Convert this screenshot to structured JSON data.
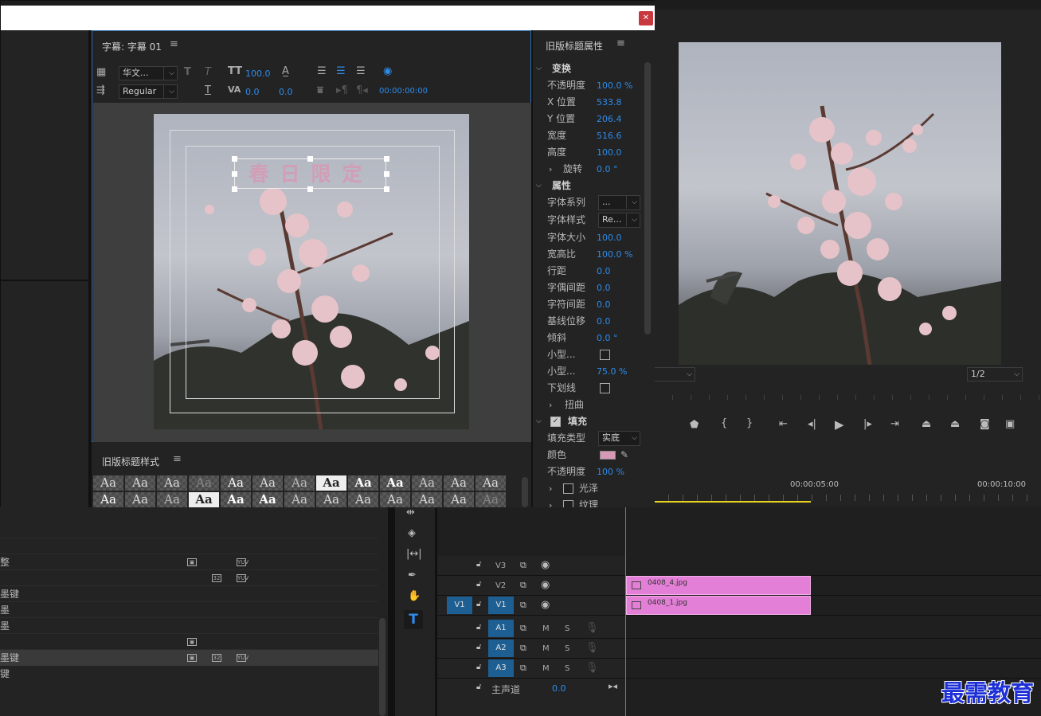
{
  "title_panel": {
    "tab_label": "字幕: 字幕 01",
    "font_family": "华文...",
    "font_style": "Regular",
    "font_size": "100.0",
    "kerning": "0.0",
    "leading": "0.0",
    "timecode": "00:00:00:00",
    "title_text": "春日限定"
  },
  "properties": {
    "header": "旧版标题属性",
    "transform_label": "变换",
    "rows_transform": [
      {
        "label": "不透明度",
        "value": "100.0 %"
      },
      {
        "label": "X 位置",
        "value": "533.8"
      },
      {
        "label": "Y 位置",
        "value": "206.4"
      },
      {
        "label": "宽度",
        "value": "516.6"
      },
      {
        "label": "高度",
        "value": "100.0"
      },
      {
        "label": "旋转",
        "value": "0.0 °"
      }
    ],
    "attr_label": "属性",
    "font_family_label": "字体系列",
    "font_family_value": "...",
    "font_style_label": "字体样式",
    "font_style_value": "Re...",
    "rows_attr": [
      {
        "label": "字体大小",
        "value": "100.0"
      },
      {
        "label": "宽高比",
        "value": "100.0 %"
      },
      {
        "label": "行距",
        "value": "0.0"
      },
      {
        "label": "字偶间距",
        "value": "0.0"
      },
      {
        "label": "字符间距",
        "value": "0.0"
      },
      {
        "label": "基线位移",
        "value": "0.0"
      },
      {
        "label": "倾斜",
        "value": "0.0 °"
      }
    ],
    "smallcaps_label": "小型...",
    "smallcaps_size_label": "小型...",
    "smallcaps_size_value": "75.0 %",
    "underline_label": "下划线",
    "distort_label": "扭曲",
    "fill_label": "填充",
    "fill_type_label": "填充类型",
    "fill_type_value": "实底",
    "color_label": "颜色",
    "fill_color": "#d79ab5",
    "fill_opacity_label": "不透明度",
    "fill_opacity_value": "100 %",
    "sheen_label": "光泽",
    "texture_label": "纹理"
  },
  "styles_panel": {
    "tab_label": "旧版标题样式",
    "swatch_text": "Aa"
  },
  "program_monitor": {
    "fit_value": "1/2",
    "ruler_marks": [
      "00:00:05:00",
      "00:00:10:00"
    ]
  },
  "timeline": {
    "video_tracks": [
      {
        "name": "V3"
      },
      {
        "name": "V2",
        "clip": "0408_4.jpg"
      },
      {
        "name": "V1",
        "clip": "0408_1.jpg",
        "source": "V1"
      }
    ],
    "audio_tracks": [
      {
        "name": "A1"
      },
      {
        "name": "A2"
      },
      {
        "name": "A3"
      }
    ],
    "master_label": "主声道",
    "master_value": "0.0",
    "mute": "M",
    "solo": "S"
  },
  "left_list": [
    {
      "text": "整",
      "row": 3
    },
    {
      "text": "",
      "row": 4
    },
    {
      "text": "墨键",
      "row": 5
    },
    {
      "text": "墨",
      "row": 6
    },
    {
      "text": "墨",
      "row": 7
    },
    {
      "text": "",
      "row": 8
    },
    {
      "text": "墨键",
      "row": 9
    },
    {
      "text": "键",
      "row": 10
    }
  ],
  "watermark": "最需教育"
}
